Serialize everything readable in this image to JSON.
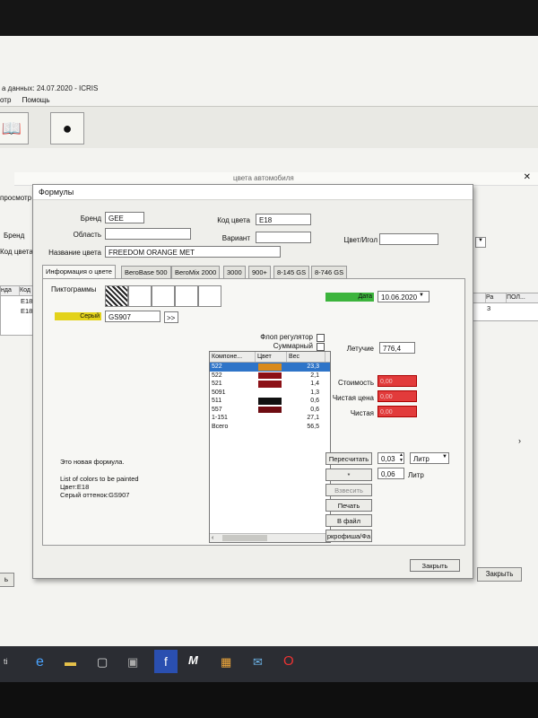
{
  "app": {
    "title_partial": "а данных: 24.07.2020 - ICRIS",
    "menu": [
      "отр",
      "Помощь"
    ],
    "second_window_title_partial": "цвета автомобиля",
    "left_labels": [
      "просмотр",
      "Бренд",
      "Код цвета",
      "нда",
      "Код",
      "E18",
      "E18"
    ],
    "right_headers": [
      "Гол",
      "Ра",
      "ПОЛ..."
    ],
    "right_value": "3",
    "left_bottom_btn": "ь",
    "right_close": "Закрыть",
    "taskbar_hint": "ti"
  },
  "dialog": {
    "title": "Формулы",
    "labels": {
      "brand": "Бренд",
      "area": "Область",
      "color_name": "Название цвета",
      "color_code": "Код цвета",
      "variant": "Вариант",
      "color_needle": "Цвет/Игол",
      "pictograms": "Пиктограммы",
      "date": "Дата",
      "flop": "Флоп регулятор",
      "cumulative": "Суммарный",
      "volatile": "Летучие",
      "cost": "Стоимость",
      "net_price": "Чистая цена",
      "net": "Чистая",
      "liter": "Литр"
    },
    "values": {
      "brand": "GEE",
      "color_code": "E18",
      "color_name": "FREEDOM ORANGE MET",
      "date": "10.06.2020",
      "gray_label": "Серый",
      "gray_value": "GS907",
      "volatile": "776,4",
      "quantity": "0,03",
      "quantity_unit": "Литр",
      "liter_value": "0,06",
      "cost": "0,00",
      "net_price": "0,00",
      "net": "0,00",
      "expand": ">>",
      "star": "*"
    },
    "tabs": [
      "Информация о цвете",
      "BeroBase 500",
      "BeroMix 2000",
      "3000",
      "900+",
      "8-145 GS",
      "8-746 GS"
    ],
    "grid": {
      "headers": [
        "Компоне...",
        "Цвет",
        "Вес"
      ],
      "rows": [
        {
          "code": "522",
          "color": "#d98a1c",
          "weight": "23,3",
          "selected": true
        },
        {
          "code": "522",
          "color": "#8c1016",
          "weight": "2,1",
          "selected": false
        },
        {
          "code": "521",
          "color": "#8c1016",
          "weight": "1,4",
          "selected": false
        },
        {
          "code": "5091",
          "color": "",
          "weight": "1,3",
          "selected": false
        },
        {
          "code": "511",
          "color": "#111111",
          "weight": "0,6",
          "selected": false
        },
        {
          "code": "557",
          "color": "#6e0c12",
          "weight": "0,6",
          "selected": false
        },
        {
          "code": "1-151",
          "color": "",
          "weight": "27,1",
          "selected": false
        },
        {
          "code": "Всего",
          "color": "",
          "weight": "56,5",
          "selected": false
        }
      ]
    },
    "notes": [
      "Это новая формула.",
      "List of colors to be painted",
      "Цвет:E18",
      "Серый оттенок:GS907"
    ],
    "buttons": {
      "recalc": "Пересчитать",
      "weigh": "Взвесить",
      "print": "Печать",
      "to_file": "В файл",
      "pictogram_file": "ркрофиша/Фа",
      "close": "Закрыть"
    }
  },
  "colors": {
    "accent_selected": "#2e74c8",
    "date_green": "#3cb43c",
    "gray_yellow": "#e3d21a",
    "red_box": "#e23b3b"
  }
}
